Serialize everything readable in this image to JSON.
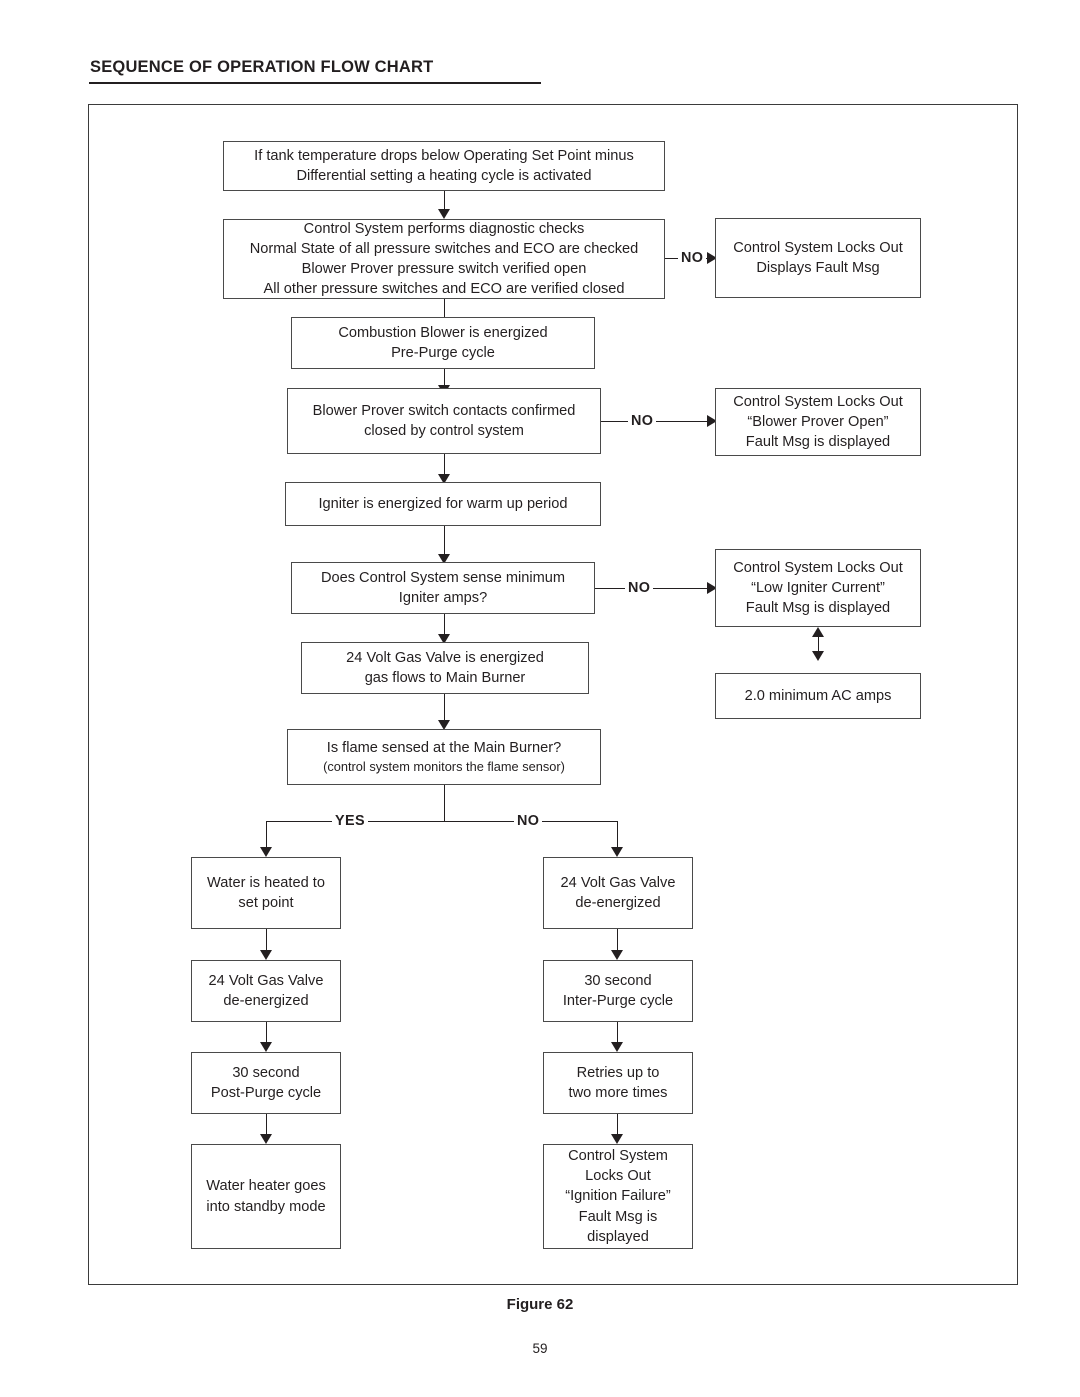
{
  "page": {
    "title": "SEQUENCE OF OPERATION FLOW CHART",
    "figure_caption": "Figure 62",
    "page_number": "59"
  },
  "flowchart": {
    "nodes": {
      "trigger": {
        "line1": "If tank temperature drops below Operating Set Point minus",
        "line2": "Differential setting a heating cycle is activated"
      },
      "diagnostics": {
        "line1": "Control System performs diagnostic checks",
        "line2": "Normal State of all pressure switches and ECO are checked",
        "line3": "Blower Prover pressure switch verified open",
        "line4": "All other pressure switches and ECO are verified closed"
      },
      "lockout_generic": {
        "line1": "Control System Locks Out",
        "line2": "Displays Fault Msg"
      },
      "blower_energized": {
        "line1": "Combustion Blower is energized",
        "line2": "Pre-Purge cycle"
      },
      "prover_confirm": {
        "line1": "Blower Prover switch contacts confirmed",
        "line2": "closed by control system"
      },
      "lockout_prover": {
        "line1": "Control System Locks Out",
        "line2": "“Blower Prover Open”",
        "line3": "Fault Msg is displayed"
      },
      "igniter_warmup": {
        "line1": "Igniter is energized for warm up period"
      },
      "igniter_amps_check": {
        "line1": "Does Control System sense minimum",
        "line2": "Igniter amps?"
      },
      "lockout_igniter": {
        "line1": "Control System Locks Out",
        "line2": "“Low Igniter Current”",
        "line3": "Fault Msg is displayed"
      },
      "min_amps": {
        "line1": "2.0 minimum AC amps"
      },
      "gas_valve_energized": {
        "line1": "24 Volt Gas Valve is energized",
        "line2": "gas flows to Main Burner"
      },
      "flame_sense": {
        "line1": "Is flame sensed at the Main Burner?",
        "line2": "(control system monitors the flame sensor)"
      },
      "water_heated": {
        "line1": "Water is heated to",
        "line2": "set point"
      },
      "gas_valve_deenergized_yes": {
        "line1": "24 Volt Gas Valve",
        "line2": "de-energized"
      },
      "post_purge": {
        "line1": "30 second",
        "line2": "Post-Purge cycle"
      },
      "standby": {
        "line1": "Water heater goes",
        "line2": "into standby mode"
      },
      "gas_valve_deenergized_no": {
        "line1": "24 Volt Gas Valve",
        "line2": "de-energized"
      },
      "inter_purge": {
        "line1": "30 second",
        "line2": "Inter-Purge cycle"
      },
      "retries": {
        "line1": "Retries up to",
        "line2": "two more times"
      },
      "lockout_ignition_failure": {
        "line1": "Control System",
        "line2": "Locks Out",
        "line3": "“Ignition Failure”",
        "line4": "Fault Msg is",
        "line5": "displayed"
      }
    },
    "edge_labels": {
      "no_diagnostics": "NO",
      "no_prover": "NO",
      "no_igniter": "NO",
      "yes_flame": "YES",
      "no_flame": "NO"
    }
  }
}
